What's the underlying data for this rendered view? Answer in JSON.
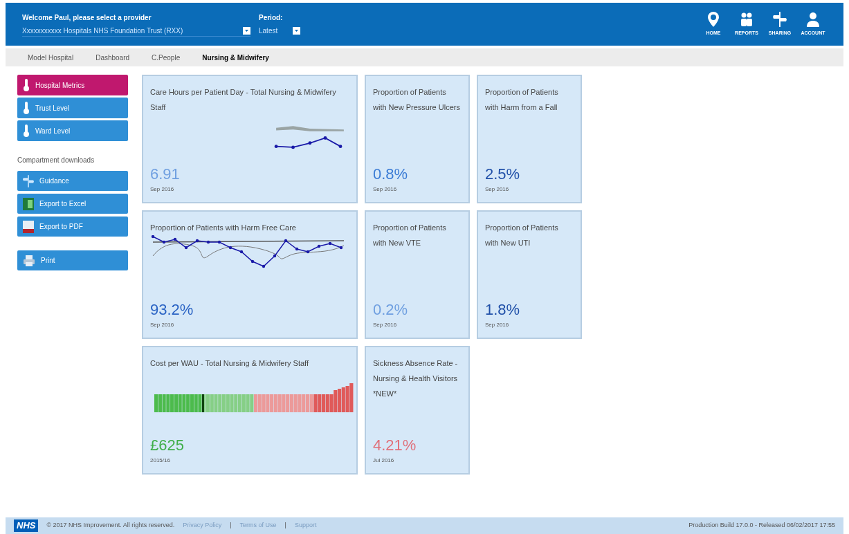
{
  "header": {
    "provider_label": "Welcome Paul, please select a provider",
    "provider": "Xxxxxxxxxxx Hospitals NHS Foundation Trust (RXX)",
    "period_label": "Period:",
    "period": "Latest",
    "icons": [
      {
        "kind": "pin",
        "label": "HOME"
      },
      {
        "kind": "people",
        "label": "REPORTS"
      },
      {
        "kind": "signpost",
        "label": "SHARING"
      },
      {
        "kind": "person",
        "label": "ACCOUNT"
      }
    ]
  },
  "tabs": [
    {
      "label": "Model Hospital",
      "selected": false
    },
    {
      "label": "Dashboard",
      "selected": false
    },
    {
      "label": "C.People",
      "selected": false
    },
    {
      "label": "Nursing & Midwifery",
      "selected": true
    }
  ],
  "sidebar": {
    "levels": [
      {
        "label": "Hospital Metrics",
        "selected": true
      },
      {
        "label": "Trust Level",
        "selected": false
      },
      {
        "label": "Ward Level",
        "selected": false
      }
    ],
    "downloads_title": "Compartment downloads",
    "downloads": [
      {
        "kind": "guidance",
        "label": "Guidance"
      },
      {
        "kind": "excel",
        "label": "Export to Excel"
      },
      {
        "kind": "pdf",
        "label": "Export to PDF"
      }
    ],
    "print": {
      "kind": "print",
      "label": "Print"
    }
  },
  "cards": [
    {
      "title": "Care Hours per Patient Day - Total Nursing & Midwifery Staff",
      "value": "6.91",
      "period": "Sep 2016",
      "color": "#6f9fe0",
      "kind": "sparkline"
    },
    {
      "title": "Proportion of Patients with New Pressure Ulcers",
      "value": "0.8%",
      "period": "Sep 2016",
      "color": "#3a7bd5"
    },
    {
      "title": "Proportion of Patients with Harm from a Fall",
      "value": "2.5%",
      "period": "Sep 2016",
      "color": "#1f4fa8"
    },
    {
      "title": "Proportion of Patients with Harm Free Care",
      "value": "93.2%",
      "period": "Sep 2016",
      "color": "#2a63c4",
      "kind": "harmfree"
    },
    {
      "title": "Proportion of Patients with New VTE",
      "value": "0.2%",
      "period": "Sep 2016",
      "color": "#6f9fe0"
    },
    {
      "title": "Proportion of Patients with New UTI",
      "value": "1.8%",
      "period": "Sep 2016",
      "color": "#1f4fa8"
    },
    {
      "title": "Cost per WAU - Total Nursing & Midwifery Staff",
      "value": "£625",
      "period": "2015/16",
      "color": "#3fae49",
      "kind": "bars"
    },
    {
      "title": "Sickness Absence Rate - Nursing & Health Visitors *NEW*",
      "value": "4.21%",
      "period": "Jul 2016",
      "color": "#e0707a"
    }
  ],
  "footer": {
    "logo": "NHS",
    "separator": "|",
    "copyright": "© 2017 NHS Improvement. All rights reserved.",
    "links": [
      "Privacy Policy",
      "Terms of Use",
      "Support"
    ],
    "build": "Production Build 17.0.0 - Released 06/02/2017 17:55"
  }
}
